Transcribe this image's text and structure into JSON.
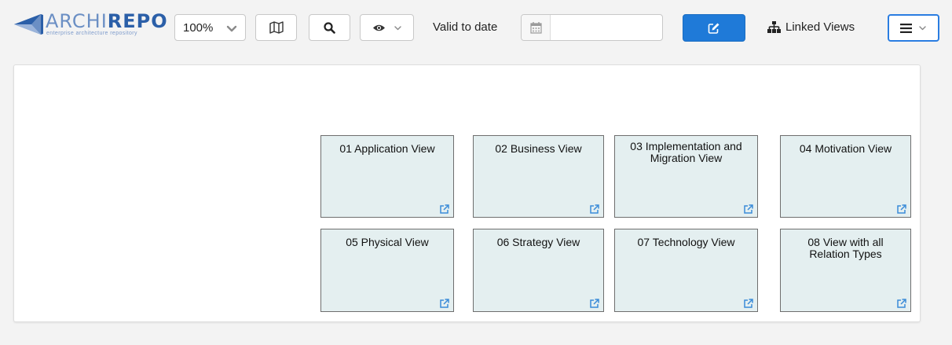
{
  "header": {
    "logo_part1": "ARCHI",
    "logo_part2": "REPO",
    "logo_tagline": "enterprise architecture repository",
    "zoom_value": "100%",
    "valid_to_label": "Valid to date",
    "date_value": "",
    "linked_views_label": "Linked Views"
  },
  "icons": {
    "logo": "archirepo-logo-mark",
    "zoom_dropdown": "chevron-down-icon",
    "map": "map-icon",
    "search": "search-icon",
    "visibility": "eye-icon",
    "calendar": "calendar-icon",
    "edit": "edit-icon",
    "linked_views": "sitemap-icon",
    "menu": "hamburger-icon",
    "tile_link": "external-link-icon"
  },
  "colors": {
    "primary": "#1f7ad8",
    "tile_bg": "#e4eff0",
    "logo_light": "#6b8fc4",
    "logo_dark": "#2b5fa8"
  },
  "views": [
    {
      "title": "01 Application View"
    },
    {
      "title": "02 Business View"
    },
    {
      "title": "03 Implementation and Migration View"
    },
    {
      "title": "04 Motivation View"
    },
    {
      "title": "05 Physical View"
    },
    {
      "title": "06 Strategy View"
    },
    {
      "title": "07 Technology View"
    },
    {
      "title": "08 View with all Relation Types"
    }
  ]
}
